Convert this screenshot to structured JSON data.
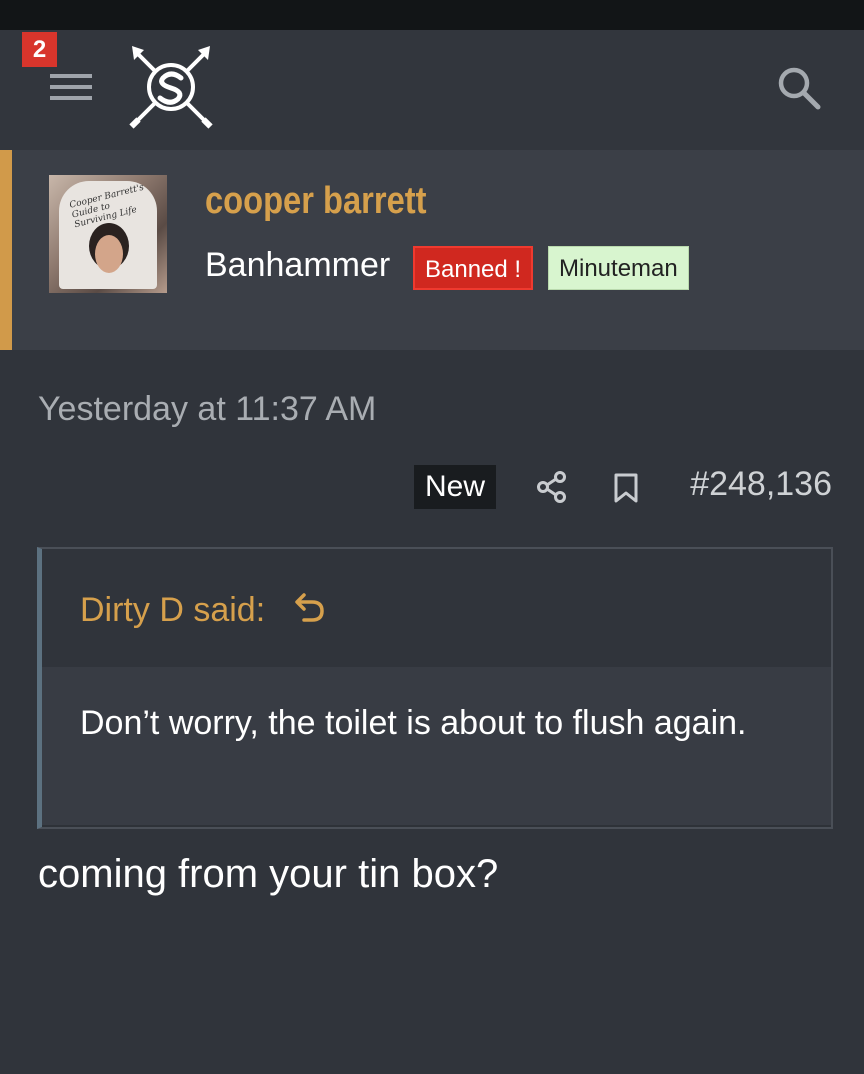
{
  "header": {
    "notification_count": "2",
    "icons": {
      "menu": "hamburger-menu-icon",
      "logo": "crossed-swords-s-logo",
      "search": "search-icon"
    }
  },
  "profile": {
    "username": "cooper barrett",
    "user_title": "Banhammer",
    "badges": [
      {
        "label": "Banned !",
        "color": "#d0281f"
      },
      {
        "label": "Minuteman",
        "color": "#d8f5cf"
      }
    ],
    "accent_color": "#d19a4a",
    "avatar_caption": "Cooper Barrett's Guide to Surviving Life"
  },
  "post": {
    "timestamp": "Yesterday at 11:37 AM",
    "new_label": "New",
    "post_number": "#248,136",
    "quote": {
      "author": "Dirty D said:",
      "text": "Don’t worry, the toilet is about to flush again."
    },
    "reply": "coming from your tin box?"
  },
  "colors": {
    "background": "#30343b",
    "name_accent": "#d6a04c",
    "banned": "#d0281f",
    "minuteman": "#d8f5cf"
  }
}
